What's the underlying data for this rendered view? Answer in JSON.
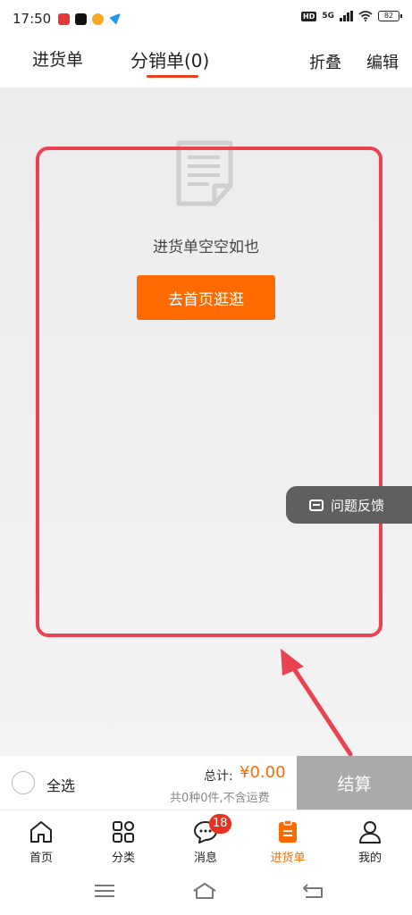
{
  "status_bar": {
    "time": "17:50",
    "network": "5G",
    "hd": "HD",
    "battery": "82"
  },
  "tabs": {
    "purchase_list": "进货单",
    "distribution_list": "分销单(0)",
    "fold": "折叠",
    "edit": "编辑"
  },
  "empty_state": {
    "message": "进货单空空如也",
    "go_home_button": "去首页逛逛"
  },
  "feedback": {
    "label": "问题反馈"
  },
  "checkout": {
    "select_all": "全选",
    "total_label": "总计:",
    "total_value": "¥0.00",
    "count_text": "共0种0件,不含运费",
    "settle_button": "结算"
  },
  "bottom_nav": {
    "items": [
      {
        "label": "首页",
        "icon": "home-icon"
      },
      {
        "label": "分类",
        "icon": "category-icon"
      },
      {
        "label": "消息",
        "icon": "message-icon",
        "badge": "18"
      },
      {
        "label": "进货单",
        "icon": "purchase-list-icon",
        "active": true
      },
      {
        "label": "我的",
        "icon": "profile-icon"
      }
    ]
  },
  "colors": {
    "accent": "#ff6a00",
    "tab_underline": "#e8421c",
    "highlight": "#ea4250",
    "badge": "#e8321f",
    "settle_disabled": "#aaaaaa"
  }
}
